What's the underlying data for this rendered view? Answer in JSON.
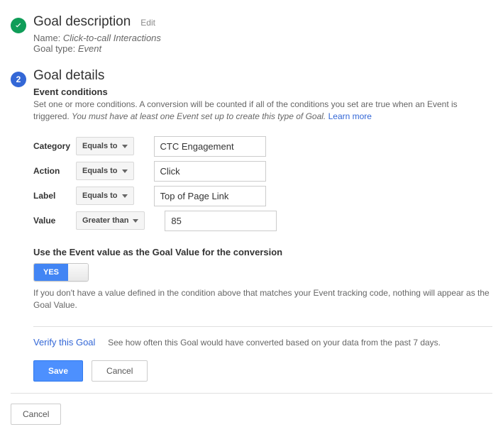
{
  "step1": {
    "title": "Goal description",
    "edit": "Edit",
    "name_label": "Name:",
    "name_value": "Click-to-call Interactions",
    "type_label": "Goal type:",
    "type_value": "Event"
  },
  "step2": {
    "number": "2",
    "title": "Goal details",
    "subheading": "Event conditions",
    "hint_a": "Set one or more conditions. A conversion will be counted if all of the conditions you set are true when an Event is triggered. ",
    "hint_b": "You must have at least one Event set up to create this type of Goal.",
    "learn_more": "Learn more",
    "rows": [
      {
        "label": "Category",
        "op": "Equals to",
        "value": "CTC Engagement"
      },
      {
        "label": "Action",
        "op": "Equals to",
        "value": "Click"
      },
      {
        "label": "Label",
        "op": "Equals to",
        "value": "Top of Page Link"
      },
      {
        "label": "Value",
        "op": "Greater than",
        "value": "85"
      }
    ],
    "use_event_value_label": "Use the Event value as the Goal Value for the conversion",
    "toggle_value": "YES",
    "value_hint": "If you don't have a value defined in the condition above that matches your Event tracking code, nothing will appear as the Goal Value.",
    "verify_link": "Verify this Goal",
    "verify_text": "See how often this Goal would have converted based on your data from the past 7 days.",
    "save": "Save",
    "cancel": "Cancel"
  },
  "outer": {
    "cancel": "Cancel"
  }
}
